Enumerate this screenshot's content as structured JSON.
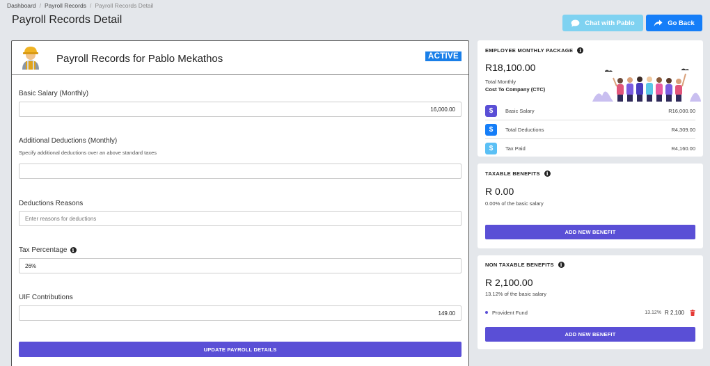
{
  "breadcrumb": [
    "Dashboard",
    "Payroll Records",
    "Payroll Records Detail"
  ],
  "page_title": "Payroll Records Detail",
  "header": {
    "chat_label": "Chat with Pablo",
    "back_label": "Go Back"
  },
  "record": {
    "title": "Payroll Records for Pablo Mekathos",
    "status": "ACTIVE",
    "basic_salary_label": "Basic Salary (Monthly)",
    "basic_salary_value": "16,000.00",
    "additional_deductions_label": "Additional Deductions (Monthly)",
    "additional_deductions_help": "Specify additional deductions over an above standard taxes",
    "additional_deductions_value": "",
    "deductions_reasons_label": "Deductions Reasons",
    "deductions_reasons_placeholder": "Enter reasons for deductions",
    "tax_percentage_label": "Tax Percentage",
    "tax_percentage_value": "26%",
    "uif_label": "UIF Contributions",
    "uif_value": "149.00",
    "update_label": "UPDATE PAYROLL DETAILS"
  },
  "package": {
    "heading": "EMPLOYEE MONTHLY PACKAGE",
    "amount": "R18,100.00",
    "sub1": "Total Monthly",
    "sub2": "Cost To Company (CTC)",
    "rows": [
      {
        "label": "Basic Salary",
        "value": "R16,000.00",
        "color": "#5a4fd6"
      },
      {
        "label": "Total Deductions",
        "value": "R4,309.00",
        "color": "#157ef8"
      },
      {
        "label": "Tax Paid",
        "value": "R4,160.00",
        "color": "#5bc0f5"
      }
    ]
  },
  "taxable": {
    "heading": "TAXABLE BENEFITS",
    "amount": "R 0.00",
    "sub": "0.00% of the basic salary",
    "button": "ADD NEW BENEFIT"
  },
  "non_taxable": {
    "heading": "NON TAXABLE BENEFITS",
    "amount": "R 2,100.00",
    "sub": "13.12% of the basic salary",
    "item": {
      "label": "Provident Fund",
      "pct": "13.12%",
      "value": "R 2,100"
    },
    "button": "ADD NEW BENEFIT"
  },
  "icons": {
    "chat": "chat-bubble-icon",
    "back": "share-arrow-icon",
    "info": "info-circle-icon",
    "avatar": "construction-worker-icon",
    "dollar": "dollar-icon",
    "delete": "trash-icon"
  },
  "colors": {
    "primary": "#5a4fd6",
    "blue": "#157ef8",
    "light_blue": "#7fd2f1",
    "danger": "#e53935"
  }
}
